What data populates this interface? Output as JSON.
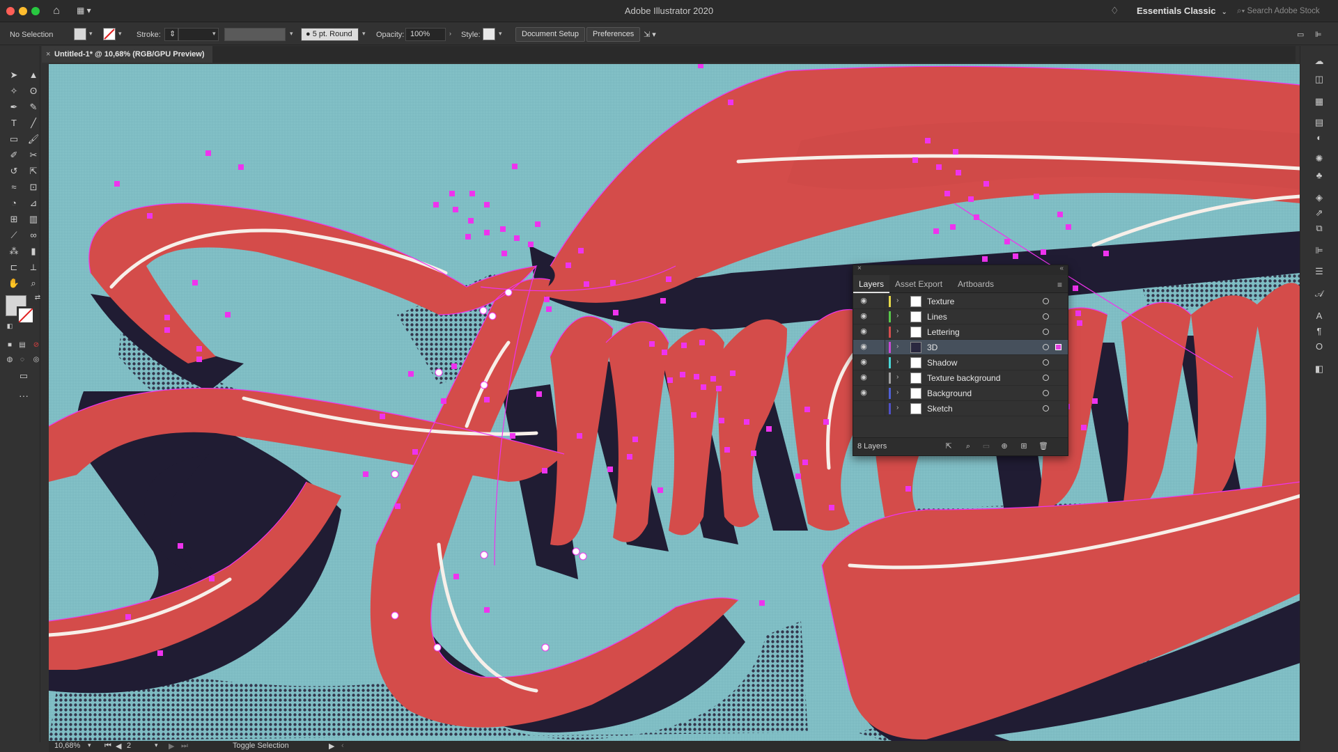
{
  "window": {
    "app_title": "Adobe Illustrator 2020",
    "workspace_label": "Essentials Classic",
    "search_placeholder": "Search Adobe Stock"
  },
  "controlbar": {
    "selection_status": "No Selection",
    "stroke_label": "Stroke:",
    "brush_value": "5 pt. Round",
    "opacity_label": "Opacity:",
    "opacity_value": "100%",
    "style_label": "Style:",
    "document_setup_label": "Document Setup",
    "preferences_label": "Preferences"
  },
  "document": {
    "tab_title": "Untitled-1* @ 10,68% (RGB/GPU Preview)"
  },
  "statusbar": {
    "zoom": "10,68%",
    "artboard_number": "2",
    "tool_status": "Toggle Selection"
  },
  "layers_panel": {
    "tabs": [
      "Layers",
      "Asset Export",
      "Artboards"
    ],
    "active_tab": "Layers",
    "layers": [
      {
        "name": "Texture",
        "color": "#e6d94a",
        "visible": true,
        "selected": false
      },
      {
        "name": "Lines",
        "color": "#59c84a",
        "visible": true,
        "selected": false
      },
      {
        "name": "Lettering",
        "color": "#d44d4d",
        "visible": true,
        "selected": false
      },
      {
        "name": "3D",
        "color": "#c94ad6",
        "visible": true,
        "selected": true
      },
      {
        "name": "Shadow",
        "color": "#4ad6d6",
        "visible": true,
        "selected": false
      },
      {
        "name": "Texture background",
        "color": "#a0a0a0",
        "visible": true,
        "selected": false
      },
      {
        "name": "Background",
        "color": "#5060d6",
        "visible": true,
        "selected": false
      },
      {
        "name": "Sketch",
        "color": "#5050c8",
        "visible": false,
        "selected": false
      }
    ],
    "count_label": "8 Layers"
  },
  "colors": {
    "canvas_bg": "#7fbdc4",
    "lettering_red": "#d44c4a",
    "extrusion_navy": "#201c33",
    "anchor_magenta": "#ee33ee"
  }
}
